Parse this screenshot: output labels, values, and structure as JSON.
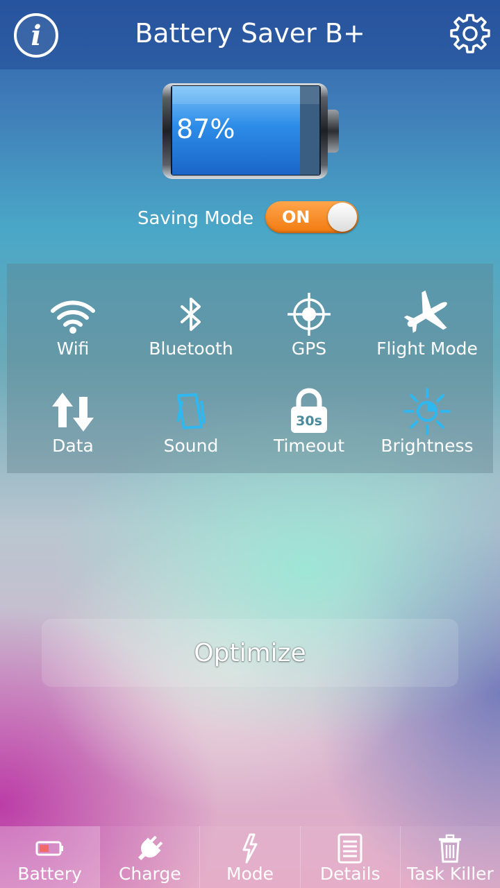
{
  "header": {
    "title": "Battery Saver B+",
    "info_icon": "info-icon",
    "settings_icon": "gear-icon"
  },
  "battery": {
    "percent_label": "87%",
    "level_fraction": 0.87
  },
  "saving_mode": {
    "label": "Saving Mode",
    "toggle_text": "ON",
    "state": "on",
    "accent": "#f5841f"
  },
  "toggles": [
    {
      "label": "Wifi",
      "icon": "wifi-icon",
      "active": false
    },
    {
      "label": "Bluetooth",
      "icon": "bluetooth-icon",
      "active": false
    },
    {
      "label": "GPS",
      "icon": "gps-icon",
      "active": false
    },
    {
      "label": "Flight Mode",
      "icon": "airplane-icon",
      "active": false
    },
    {
      "label": "Data",
      "icon": "data-transfer-icon",
      "active": false
    },
    {
      "label": "Sound",
      "icon": "vibrate-icon",
      "active": true
    },
    {
      "label": "Timeout",
      "icon": "timeout-lock-icon",
      "badge": "30s",
      "active": false
    },
    {
      "label": "Brightness",
      "icon": "brightness-icon",
      "active": true
    }
  ],
  "active_color": "#2fb8f0",
  "optimize": {
    "label": "Optimize"
  },
  "bottom_nav": [
    {
      "label": "Battery",
      "icon": "battery-icon",
      "selected": true
    },
    {
      "label": "Charge",
      "icon": "plug-icon",
      "selected": false
    },
    {
      "label": "Mode",
      "icon": "lightning-icon",
      "selected": false
    },
    {
      "label": "Details",
      "icon": "document-icon",
      "selected": false
    },
    {
      "label": "Task Killer",
      "icon": "trash-icon",
      "selected": false
    }
  ]
}
